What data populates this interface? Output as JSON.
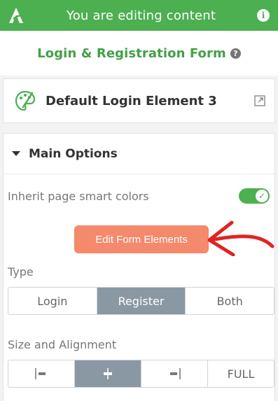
{
  "topbar": {
    "title": "You are editing content",
    "logo_icon": "thrive-architect-logo-icon",
    "info_icon": "i"
  },
  "heading": {
    "title": "Login & Registration Form",
    "help_icon": "?"
  },
  "element": {
    "title": "Default Login Element 3",
    "icon": "palette-icon",
    "link_icon": "external-link-icon"
  },
  "main_options": {
    "title": "Main Options",
    "smart_colors_label": "Inherit page smart colors",
    "smart_colors_enabled": true,
    "toggle_check": "✓",
    "edit_button": "Edit Form Elements",
    "type_label": "Type",
    "type_options": [
      "Login",
      "Register",
      "Both"
    ],
    "type_selected": "Register",
    "size_label": "Size and Alignment",
    "size_options": [
      "|▬",
      "┿",
      "▬|",
      "FULL"
    ],
    "size_selected": "center"
  },
  "colors": {
    "green": "#4caf50",
    "accent_button": "#f4896b",
    "annotation_red": "#e02424",
    "segment_active": "#8a98a4"
  }
}
